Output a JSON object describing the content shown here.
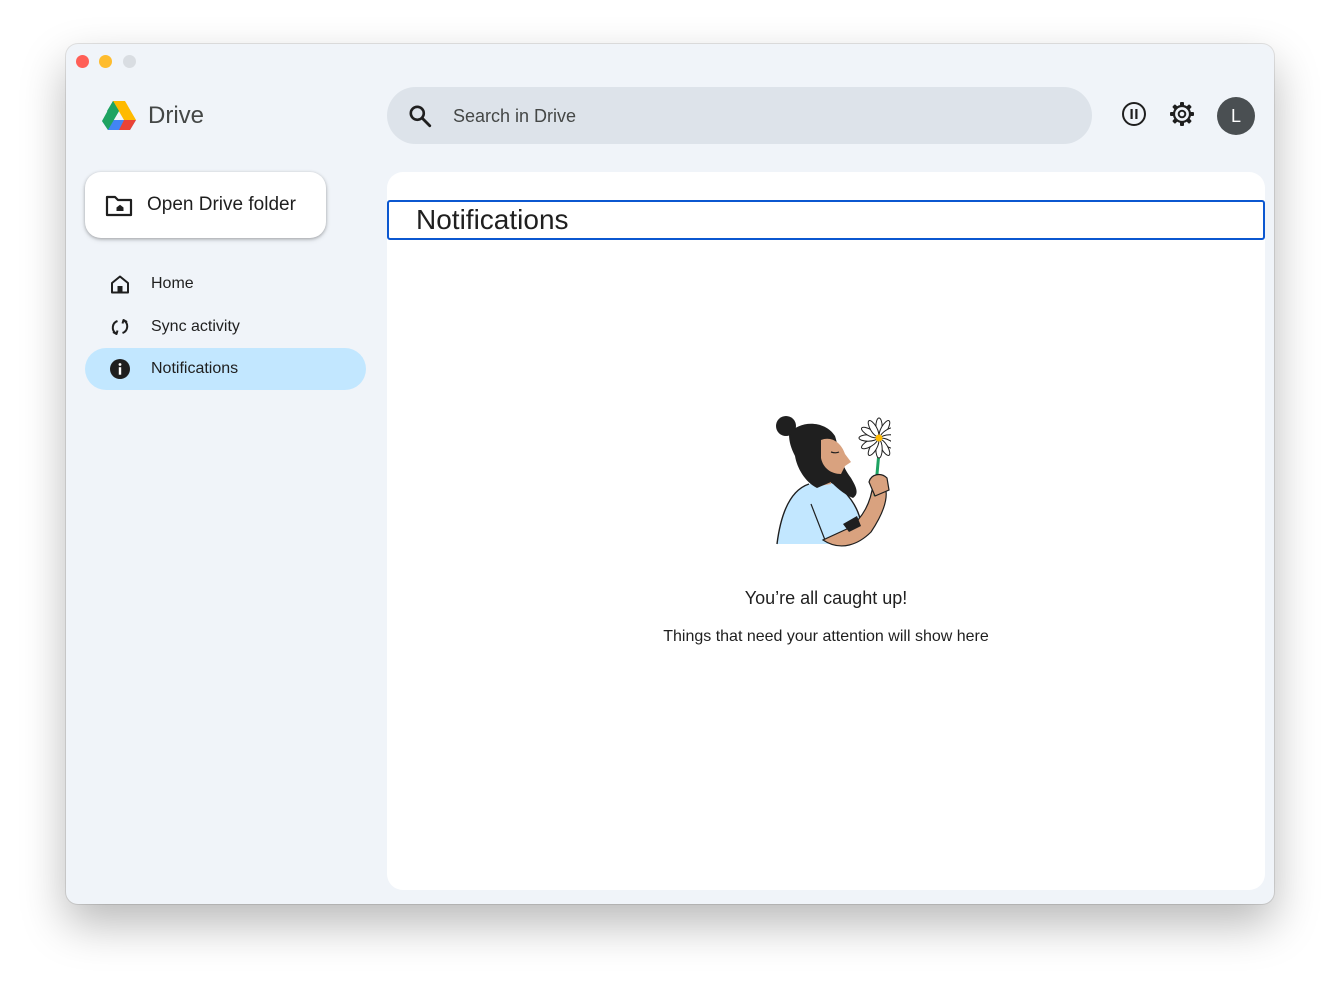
{
  "app": {
    "title": "Drive",
    "avatar_initial": "L"
  },
  "search": {
    "placeholder": "Search in Drive",
    "value": ""
  },
  "sidebar": {
    "open_folder_label": "Open Drive folder",
    "items": [
      {
        "label": "Home",
        "icon": "home-icon",
        "active": false
      },
      {
        "label": "Sync activity",
        "icon": "sync-icon",
        "active": false
      },
      {
        "label": "Notifications",
        "icon": "info-icon",
        "active": true
      }
    ]
  },
  "main": {
    "title": "Notifications",
    "empty_title": "You’re all caught up!",
    "empty_subtitle": "Things that need your attention will show here"
  },
  "icons": {
    "search": "search-icon",
    "pause": "pause-circle-icon",
    "settings": "gear-icon",
    "folder": "folder-icon",
    "logo": "drive-logo-icon"
  },
  "colors": {
    "window_bg": "#f0f4f9",
    "search_bg": "#dde3ea",
    "active_nav": "#c2e7ff",
    "focus_outline": "#0b57d0",
    "avatar_bg": "#4a4f52",
    "drive_green": "#1ea362",
    "drive_blue": "#4285f4",
    "drive_yellow": "#ffba00",
    "drive_red": "#ea4335"
  }
}
